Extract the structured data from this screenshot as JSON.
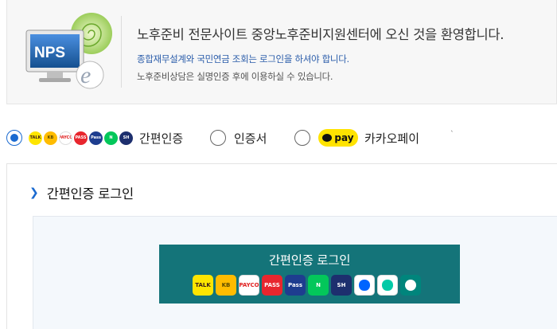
{
  "banner": {
    "logo_text": "NPS",
    "welcome": "노후준비 전문사이트 중앙노후준비지원센터에 오신 것을 환영합니다.",
    "notice_login": "종합재무설계와 국민연금 조회는 로그인을 하셔야 합니다.",
    "notice_auth": "노후준비상담은 실명인증 후에 이용하실 수 있습니다."
  },
  "login_types": [
    {
      "label": "간편인증",
      "checked": true
    },
    {
      "label": "인증서",
      "checked": false
    },
    {
      "label": "카카오페이",
      "checked": false,
      "badge": "pay"
    }
  ],
  "tick": "`",
  "mini_icons": [
    {
      "name": "kakao-talk-icon",
      "text": "TALK",
      "color": "#fee500",
      "fg": "#3a1d1d"
    },
    {
      "name": "kb-icon",
      "text": "KB",
      "color": "#ffbc00",
      "fg": "#5a4a00"
    },
    {
      "name": "payco-icon",
      "text": "PAYCO",
      "color": "#ffffff",
      "fg": "#e02020"
    },
    {
      "name": "pass-icon",
      "text": "PASS",
      "color": "#e8262e",
      "fg": "#ffffff"
    },
    {
      "name": "samsung-pass-icon",
      "text": "Pass",
      "color": "#1e3d8f",
      "fg": "#ffffff"
    },
    {
      "name": "naver-icon",
      "text": "N",
      "color": "#03c75a",
      "fg": "#ffffff"
    },
    {
      "name": "shinhan-icon",
      "text": "SH",
      "color": "#1d2f6e",
      "fg": "#ffffff"
    }
  ],
  "panel": {
    "title": "간편인증 로그인",
    "button_label": "간편인증 로그인"
  },
  "button_icons": [
    {
      "name": "kakao-talk-icon",
      "text": "TALK",
      "color": "#fee500",
      "fg": "#3a1d1d"
    },
    {
      "name": "kb-icon",
      "text": "KB",
      "color": "#ffbc00",
      "fg": "#5a4a00"
    },
    {
      "name": "payco-icon",
      "text": "PAYCO",
      "color": "#ffffff",
      "fg": "#e02020"
    },
    {
      "name": "pass-icon",
      "text": "PASS",
      "color": "#e8262e",
      "fg": "#ffffff"
    },
    {
      "name": "samsung-pass-icon",
      "text": "Pass",
      "color": "#1e3d8f",
      "fg": "#ffffff"
    },
    {
      "name": "naver-icon",
      "text": "N",
      "color": "#03c75a",
      "fg": "#ffffff"
    },
    {
      "name": "shinhan-icon",
      "text": "SH",
      "color": "#1d2f6e",
      "fg": "#ffffff"
    },
    {
      "name": "toss-icon",
      "text": "",
      "color": "#ffffff",
      "fg": "#0064ff"
    },
    {
      "name": "banksalad-icon",
      "text": "",
      "color": "#ffffff",
      "fg": "#00c9a7"
    },
    {
      "name": "hana-icon",
      "text": "",
      "color": "#00857c",
      "fg": "#ffffff"
    }
  ]
}
